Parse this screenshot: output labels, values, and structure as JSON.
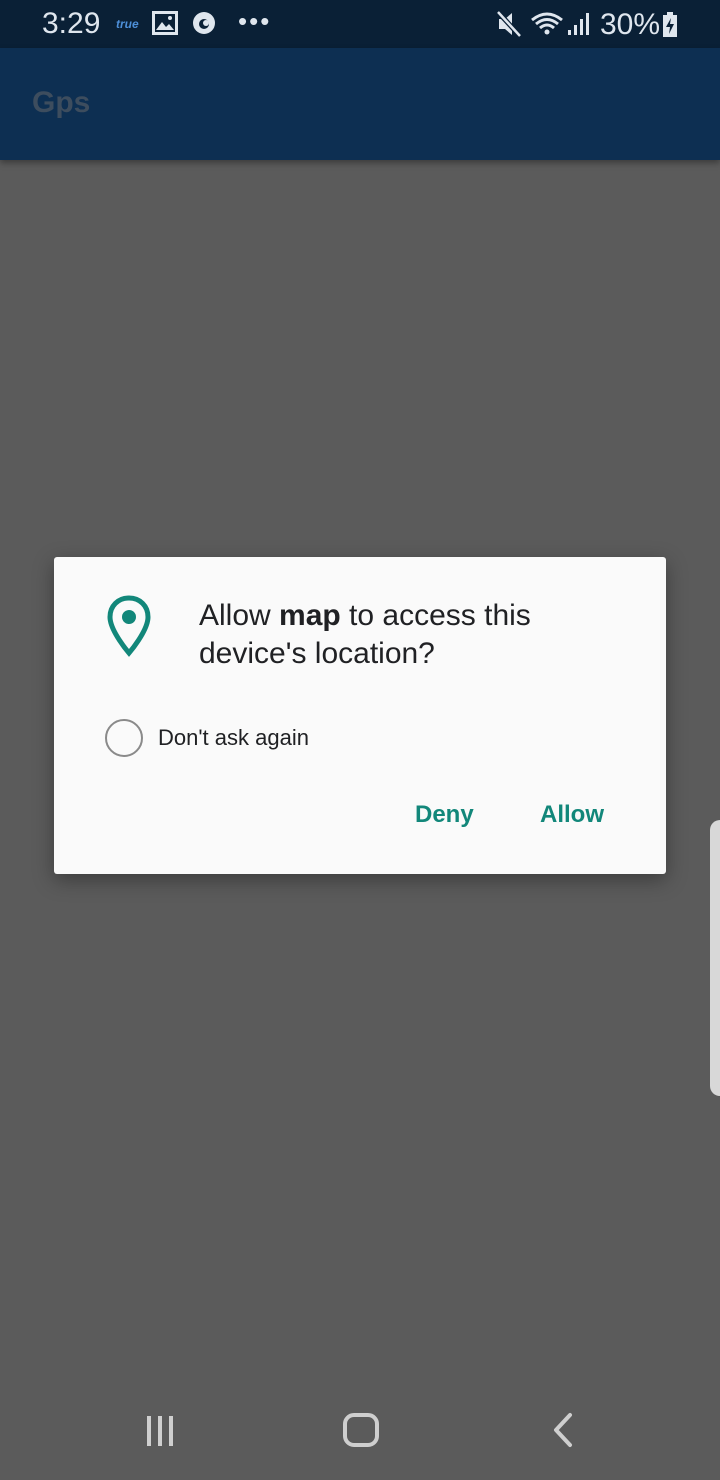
{
  "status_bar": {
    "time": "3:29",
    "carrier": "true",
    "dots": "•••",
    "battery": "30%",
    "icons": [
      "image-icon",
      "vodafone-icon",
      "mute-icon",
      "wifi-icon",
      "signal-icon",
      "battery-charging-icon"
    ]
  },
  "app_bar": {
    "title": "Gps"
  },
  "dialog": {
    "icon": "location-pin-icon",
    "message_prefix": "Allow ",
    "app_name": "map",
    "message_suffix": " to access this device's location?",
    "dont_ask_label": "Don't ask again",
    "dont_ask_checked": false,
    "deny_label": "Deny",
    "allow_label": "Allow",
    "accent_color": "#12877a"
  },
  "nav_bar": {
    "icons": [
      "recent-apps-icon",
      "home-icon",
      "back-icon"
    ]
  },
  "colors": {
    "status_bar": "#0a2036",
    "app_bar": "#0d2f52",
    "scrim": "#5b5b5b",
    "dialog_bg": "#fafafa"
  }
}
